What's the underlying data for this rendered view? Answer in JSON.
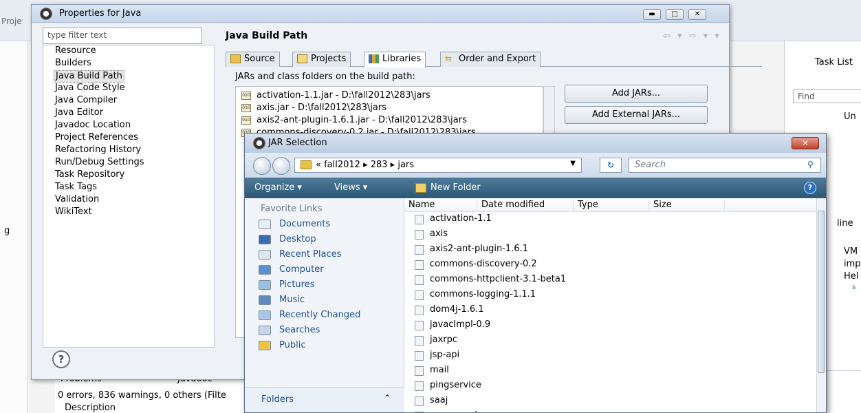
{
  "workbench": {
    "projects_label": "Proje",
    "left_letter": "g",
    "task_list": "Task List",
    "find_placeholder": "Find",
    "uncategorized": "Un",
    "outline": "line",
    "outline_items": [
      "VM",
      "imp",
      "Hel",
      "s"
    ],
    "problems_tab": "Problems",
    "javadoc_tab": "Javadoc",
    "problems_summary": "0 errors, 836 warnings, 0 others (Filte",
    "description_col": "Description"
  },
  "properties": {
    "title": "Properties for Java",
    "filter_placeholder": "type filter text",
    "tree": [
      "Resource",
      "Builders",
      "Java Build Path",
      "Java Code Style",
      "Java Compiler",
      "Java Editor",
      "Javadoc Location",
      "Project References",
      "Refactoring History",
      "Run/Debug Settings",
      "Task Repository",
      "Task Tags",
      "Validation",
      "WikiText"
    ],
    "page_title": "Java Build Path",
    "tabs": [
      "Source",
      "Projects",
      "Libraries",
      "Order and Export"
    ],
    "jars_label": "JARs and class folders on the build path:",
    "jars": [
      "activation-1.1.jar - D:\\fall2012\\283\\jars",
      "axis.jar - D:\\fall2012\\283\\jars",
      "axis2-ant-plugin-1.6.1.jar - D:\\fall2012\\283\\jars",
      "commons-discovery-0.2.jar - D:\\fall2012\\283\\jars"
    ],
    "buttons": [
      "Add JARs...",
      "Add External JARs..."
    ],
    "help_icon": "?"
  },
  "jar_selection": {
    "title": "JAR Selection",
    "address": "« fall2012 ▸ 283 ▸ jars",
    "search_placeholder": "Search",
    "toolbar": {
      "organize": "Organize ▾",
      "views": "Views ▾",
      "new_folder": "New Folder"
    },
    "favorite_links_header": "Favorite Links",
    "favorite_links": [
      "Documents",
      "Desktop",
      "Recent Places",
      "Computer",
      "Pictures",
      "Music",
      "Recently Changed",
      "Searches",
      "Public"
    ],
    "folders_label": "Folders",
    "columns": [
      "Name",
      "Date modified",
      "Type",
      "Size"
    ],
    "files": [
      "activation-1.1",
      "axis",
      "axis2-ant-plugin-1.6.1",
      "commons-discovery-0.2",
      "commons-httpclient-3.1-beta1",
      "commons-logging-1.1.1",
      "dom4j-1.6.1",
      "javacImpl-0.9",
      "jaxrpc",
      "jsp-api",
      "mail",
      "pingservice",
      "saaj",
      "serverpool"
    ]
  }
}
